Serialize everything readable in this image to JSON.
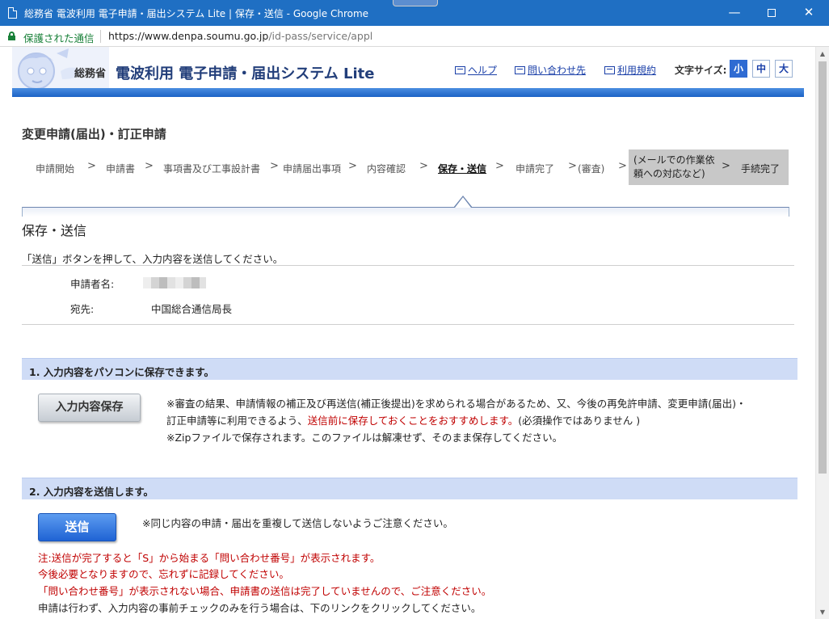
{
  "window": {
    "title": "総務省 電波利用 電子申請・届出システム Lite | 保存・送信 - Google Chrome",
    "minimize": "—",
    "close": "✕"
  },
  "address": {
    "secure_label": "保護された通信",
    "url_host": "https://www.denpa.soumu.go.jp",
    "url_path": "/id-pass/service/appl"
  },
  "header": {
    "ministry": "総務省",
    "system_title": "電波利用 電子申請・届出システム Lite",
    "links": {
      "help": "ヘルプ",
      "contact": "問い合わせ先",
      "terms": "利用規約"
    },
    "font_size_label": "文字サイズ:",
    "font_sizes": {
      "small": "小",
      "medium": "中",
      "large": "大"
    }
  },
  "page": {
    "heading": "変更申請(届出)・訂正申請",
    "steps": [
      "申請開始",
      "申請書",
      "事項書及び工事設計書",
      "申請届出事項",
      "内容確認",
      "保存・送信",
      "申請完了",
      "(審査)",
      "(メールでの作業依頼への対応など)",
      "手続完了"
    ],
    "step_separator": ">",
    "current_step": "保存・送信",
    "section_title": "保存・送信",
    "instruction": "「送信」ボタンを押して、入力内容を送信してください。",
    "applicant_label": "申請者名:",
    "destination_label": "宛先:",
    "destination_value": "中国総合通信局長"
  },
  "save_section": {
    "title": "1. 入力内容をパソコンに保存できます。",
    "button": "入力内容保存",
    "note_line1": "※審査の結果、申請情報の補正及び再送信(補正後提出)を求められる場合があるため、又、今後の再免許申請、変更申請(届出)・",
    "note_line2_pre": "訂正申請等に利用できるよう、",
    "note_line2_red": "送信前に保存しておくことをおすすめします。",
    "note_line2_post": "(必須操作ではありません )",
    "note_line3": "※Zipファイルで保存されます。このファイルは解凍せず、そのまま保存してください。"
  },
  "send_section": {
    "title": "2. 入力内容を送信します。",
    "button": "送信",
    "note": "※同じ内容の申請・届出を重複して送信しないようご注意ください。",
    "warning_line1": "注:送信が完了すると「S」から始まる「問い合わせ番号」が表示されます。",
    "warning_line2": "今後必要となりますので、忘れずに記録してください。",
    "warning_line3": "「問い合わせ番号」が表示されない場合、申請書の送信は完了していませんので、ご注意ください。",
    "precheck_note": "申請は行わず、入力内容の事前チェックのみを行う場合は、下のリンクをクリックしてください。"
  },
  "colors": {
    "chrome_title": "#1f6fc3",
    "header_band": "#1c63c6",
    "section_band": "#cfdcf6",
    "warning_red": "#c00000",
    "send_button": "#1f63d4"
  }
}
